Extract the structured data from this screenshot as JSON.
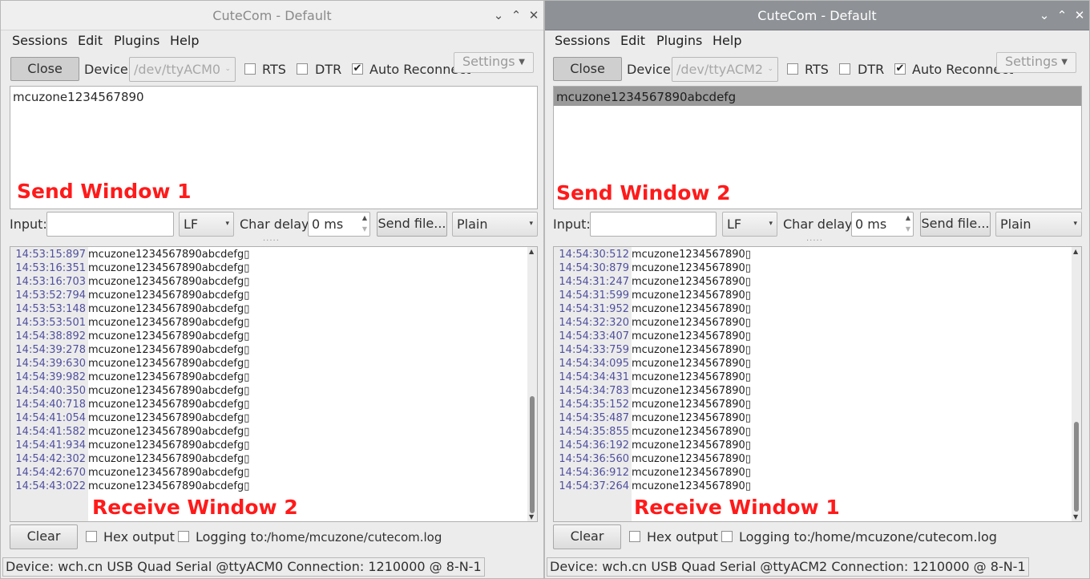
{
  "left": {
    "title": "CuteCom - Default",
    "menu": [
      "Sessions",
      "Edit",
      "Plugins",
      "Help"
    ],
    "close_label": "Close",
    "device_label": "Device:",
    "device_value": "/dev/ttyACM0",
    "rts_label": "RTS",
    "dtr_label": "DTR",
    "auto_reconnect_label": "Auto Reconnect",
    "settings_label": "Settings",
    "send_text": "mcuzone1234567890",
    "send_annotation": "Send Window 1",
    "input_label": "Input:",
    "input_value": "",
    "line_ending": "LF",
    "char_delay_label": "Char delay:",
    "char_delay_value": "0 ms",
    "send_file_label": "Send file...",
    "format_value": "Plain",
    "receive_annotation": "Receive Window 2",
    "receive_lines": [
      {
        "ts": "14:53:15:897",
        "msg": "mcuzone1234567890abcdefg"
      },
      {
        "ts": "14:53:16:351",
        "msg": "mcuzone1234567890abcdefg"
      },
      {
        "ts": "14:53:16:703",
        "msg": "mcuzone1234567890abcdefg"
      },
      {
        "ts": "14:53:52:794",
        "msg": "mcuzone1234567890abcdefg"
      },
      {
        "ts": "14:53:53:148",
        "msg": "mcuzone1234567890abcdefg"
      },
      {
        "ts": "14:53:53:501",
        "msg": "mcuzone1234567890abcdefg"
      },
      {
        "ts": "14:54:38:892",
        "msg": "mcuzone1234567890abcdefg"
      },
      {
        "ts": "14:54:39:278",
        "msg": "mcuzone1234567890abcdefg"
      },
      {
        "ts": "14:54:39:630",
        "msg": "mcuzone1234567890abcdefg"
      },
      {
        "ts": "14:54:39:982",
        "msg": "mcuzone1234567890abcdefg"
      },
      {
        "ts": "14:54:40:350",
        "msg": "mcuzone1234567890abcdefg"
      },
      {
        "ts": "14:54:40:718",
        "msg": "mcuzone1234567890abcdefg"
      },
      {
        "ts": "14:54:41:054",
        "msg": "mcuzone1234567890abcdefg"
      },
      {
        "ts": "14:54:41:582",
        "msg": "mcuzone1234567890abcdefg"
      },
      {
        "ts": "14:54:41:934",
        "msg": "mcuzone1234567890abcdefg"
      },
      {
        "ts": "14:54:42:302",
        "msg": "mcuzone1234567890abcdefg"
      },
      {
        "ts": "14:54:42:670",
        "msg": "mcuzone1234567890abcdefg"
      },
      {
        "ts": "14:54:43:022",
        "msg": "mcuzone1234567890abcdefg"
      }
    ],
    "clear_label": "Clear",
    "hex_output_label": "Hex output",
    "logging_label": "Logging to:",
    "log_path": "/home/mcuzone/cutecom.log",
    "status_device": "Device:  wch.cn USB Quad Serial @ttyACM0  Connection:  1210000 @ 8-N-1"
  },
  "right": {
    "title": "CuteCom - Default",
    "menu": [
      "Sessions",
      "Edit",
      "Plugins",
      "Help"
    ],
    "close_label": "Close",
    "device_label": "Device:",
    "device_value": "/dev/ttyACM2",
    "rts_label": "RTS",
    "dtr_label": "DTR",
    "auto_reconnect_label": "Auto Reconnect",
    "settings_label": "Settings",
    "send_text": "mcuzone1234567890abcdefg",
    "send_annotation": "Send Window 2",
    "input_label": "Input:",
    "input_value": "",
    "line_ending": "LF",
    "char_delay_label": "Char delay:",
    "char_delay_value": "0 ms",
    "send_file_label": "Send file...",
    "format_value": "Plain",
    "receive_annotation": "Receive Window 1",
    "receive_lines": [
      {
        "ts": "14:54:30:512",
        "msg": "mcuzone1234567890"
      },
      {
        "ts": "14:54:30:879",
        "msg": "mcuzone1234567890"
      },
      {
        "ts": "14:54:31:247",
        "msg": "mcuzone1234567890"
      },
      {
        "ts": "14:54:31:599",
        "msg": "mcuzone1234567890"
      },
      {
        "ts": "14:54:31:952",
        "msg": "mcuzone1234567890"
      },
      {
        "ts": "14:54:32:320",
        "msg": "mcuzone1234567890"
      },
      {
        "ts": "14:54:33:407",
        "msg": "mcuzone1234567890"
      },
      {
        "ts": "14:54:33:759",
        "msg": "mcuzone1234567890"
      },
      {
        "ts": "14:54:34:095",
        "msg": "mcuzone1234567890"
      },
      {
        "ts": "14:54:34:431",
        "msg": "mcuzone1234567890"
      },
      {
        "ts": "14:54:34:783",
        "msg": "mcuzone1234567890"
      },
      {
        "ts": "14:54:35:152",
        "msg": "mcuzone1234567890"
      },
      {
        "ts": "14:54:35:487",
        "msg": "mcuzone1234567890"
      },
      {
        "ts": "14:54:35:855",
        "msg": "mcuzone1234567890"
      },
      {
        "ts": "14:54:36:192",
        "msg": "mcuzone1234567890"
      },
      {
        "ts": "14:54:36:560",
        "msg": "mcuzone1234567890"
      },
      {
        "ts": "14:54:36:912",
        "msg": "mcuzone1234567890"
      },
      {
        "ts": "14:54:37:264",
        "msg": "mcuzone1234567890"
      }
    ],
    "clear_label": "Clear",
    "hex_output_label": "Hex output",
    "logging_label": "Logging to:",
    "log_path": "/home/mcuzone/cutecom.log",
    "status_device": "Device:  wch.cn USB Quad Serial @ttyACM2  Connection:  1210000 @ 8-N-1"
  },
  "colors": {
    "timestamp": "#5050a0",
    "annotation": "#ff1a1a",
    "active_titlebar": "#8e9195",
    "window_bg": "#ececec"
  },
  "icons": [
    "chevron-down-icon",
    "caret-up-icon",
    "close-icon",
    "checkmark-icon",
    "dropdown-arrow-icon",
    "spin-up-icon",
    "spin-down-icon"
  ]
}
